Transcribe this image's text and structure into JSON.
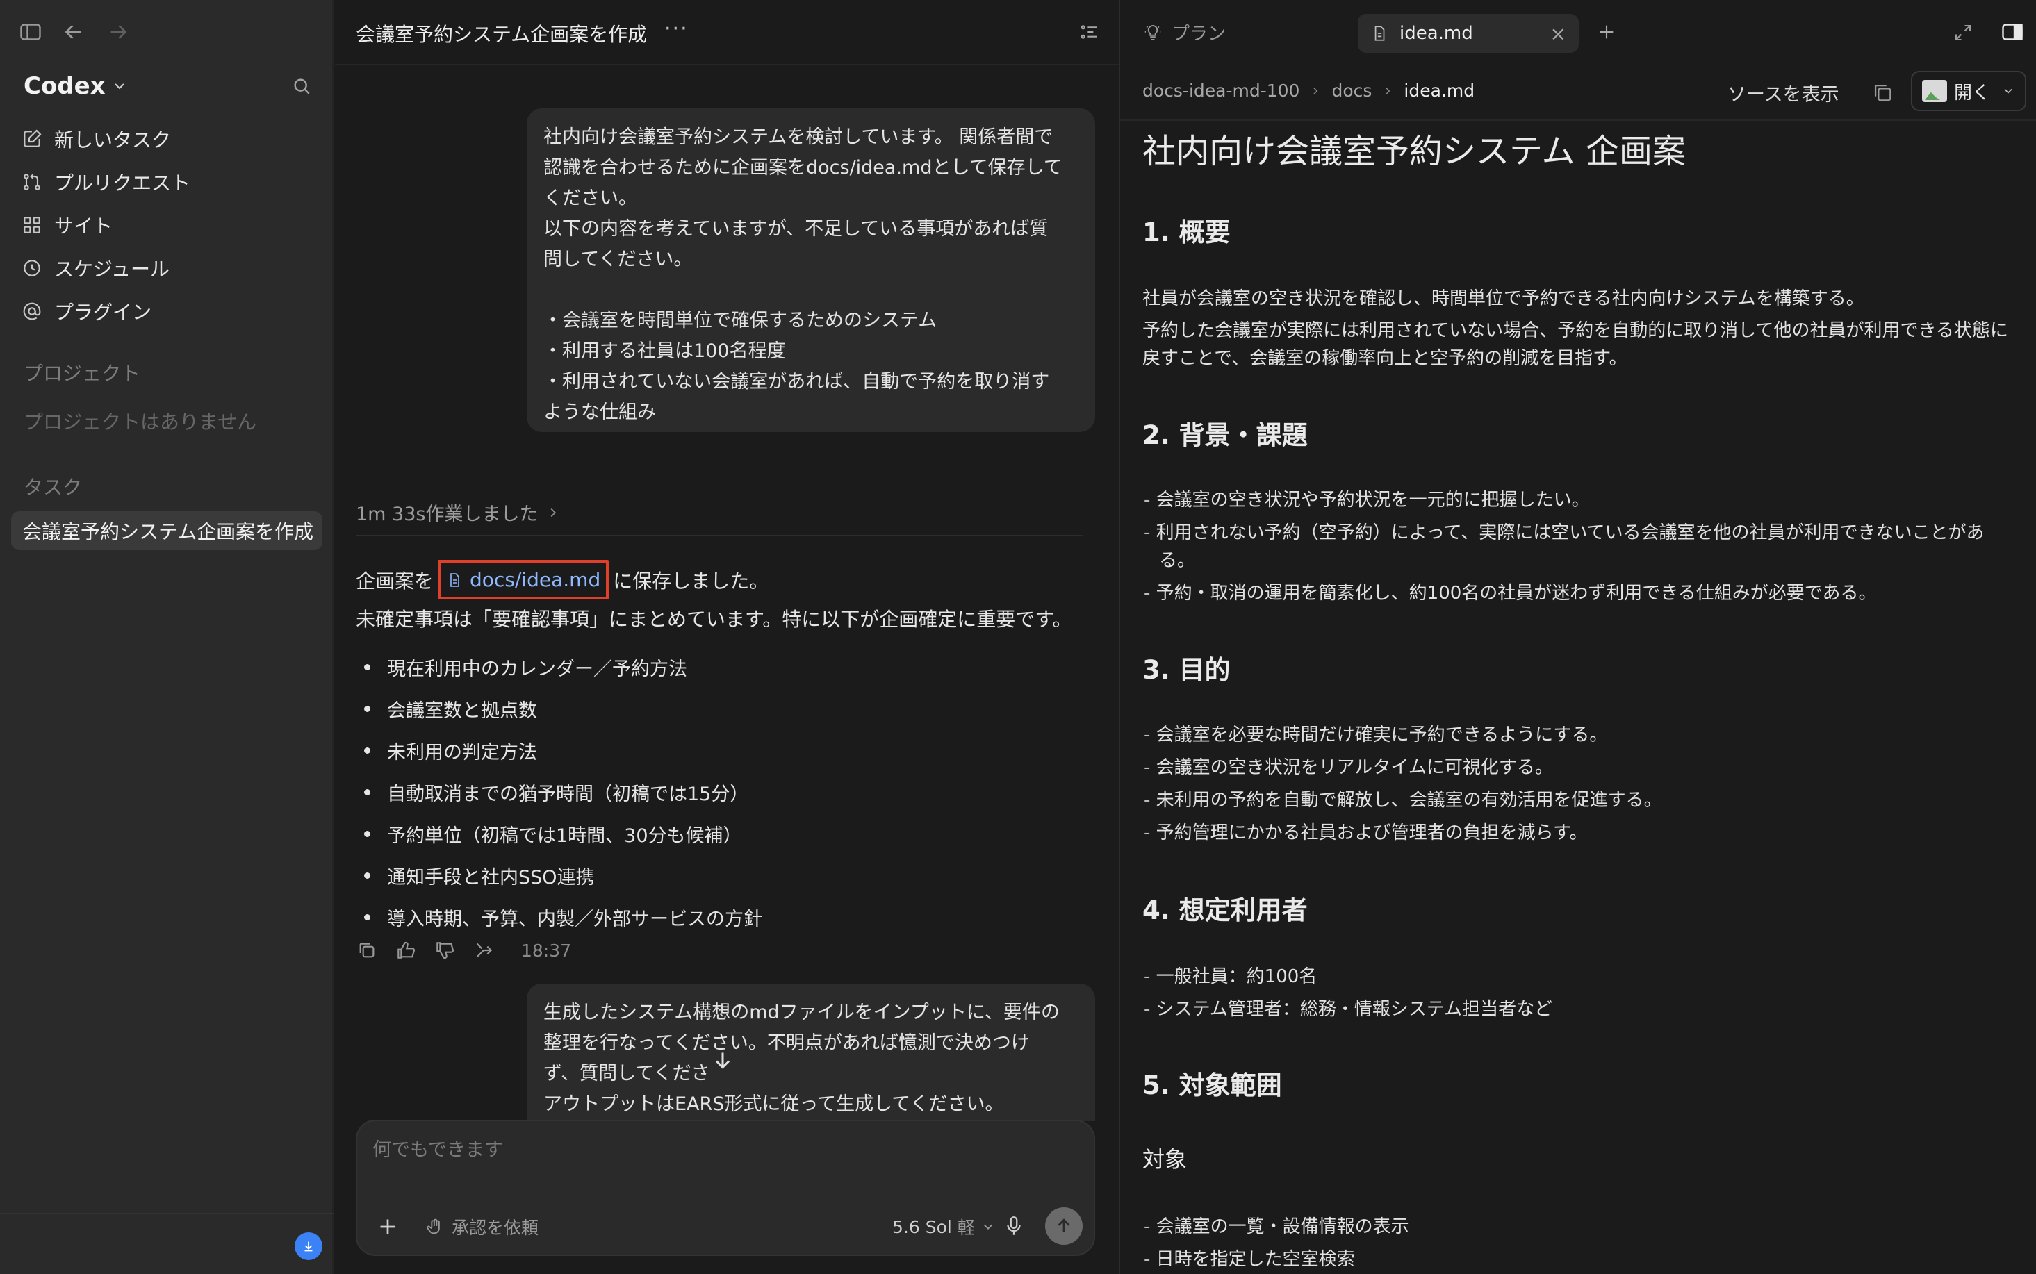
{
  "sidebar": {
    "brand": "Codex",
    "nav": [
      {
        "icon": "edit-icon",
        "label": "新しいタスク"
      },
      {
        "icon": "pull-request-icon",
        "label": "プルリクエスト"
      },
      {
        "icon": "grid-icon",
        "label": "サイト"
      },
      {
        "icon": "clock-icon",
        "label": "スケジュール"
      },
      {
        "icon": "at-icon",
        "label": "プラグイン"
      }
    ],
    "projects_label": "プロジェクト",
    "projects_empty": "プロジェクトはありません",
    "tasks_label": "タスク",
    "active_task": "会議室予約システム企画案を作成"
  },
  "chat": {
    "title": "会議室予約システム企画案を作成",
    "more": "···",
    "user_message_1": "社内向け会議室予約システムを検討しています。 関係者間で\n認識を合わせるために企画案をdocs/idea.mdとして保存して\nください。\n以下の内容を考えていますが、不足している事項があれば質\n問してください。\n\n・会議室を時間単位で確保するためのシステム\n・利用する社員は100名程度\n・利用されていない会議室があれば、自動で予約を取り消す\nような仕組み",
    "worked": "1m 33s作業しました",
    "saved_prefix": "企画案を",
    "file_link": "docs/idea.md",
    "saved_suffix": "に保存しました。",
    "summary": "未確定事項は「要確認事項」にまとめています。特に以下が企画確定に重要です。",
    "bullets": [
      "現在利用中のカレンダー／予約方法",
      "会議室数と拠点数",
      "未利用の判定方法",
      "自動取消までの猶予時間（初稿では15分）",
      "予約単位（初稿では1時間、30分も候補）",
      "通知手段と社内SSO連携",
      "導入時期、予算、内製／外部サービスの方針"
    ],
    "time": "18:37",
    "user_message_2": "生成したシステム構想のmdファイルをインプットに、要件の\n整理を行なってください。不明点があれば憶測で決めつけ\nず、質問してくださ\nアウトプットはEARS形式に従って生成してください。"
  },
  "composer": {
    "placeholder": "何でもできます",
    "approval": "承認を依頼",
    "model": "5.6 Sol",
    "effort": "軽"
  },
  "doc": {
    "tab_plan": "プラン",
    "tab_file": "idea.md",
    "breadcrumb": [
      "docs-idea-md-100",
      "docs",
      "idea.md"
    ],
    "view_source": "ソースを表示",
    "open": "開く",
    "title": "社内向け会議室予約システム 企画案",
    "s1_heading": "1. 概要",
    "s1_p1": "社員が会議室の空き状況を確認し、時間単位で予約できる社内向けシステムを構築する。",
    "s1_p2": "予約した会議室が実際には利用されていない場合、予約を自動的に取り消して他の社員が利用できる状態に戻すことで、会議室の稼働率向上と空予約の削減を目指す。",
    "s2_heading": "2. 背景・課題",
    "s2_items": [
      "会議室の空き状況や予約状況を一元的に把握したい。",
      "利用されない予約（空予約）によって、実際には空いている会議室を他の社員が利用できないことがある。",
      "予約・取消の運用を簡素化し、約100名の社員が迷わず利用できる仕組みが必要である。"
    ],
    "s3_heading": "3. 目的",
    "s3_items": [
      "会議室を必要な時間だけ確実に予約できるようにする。",
      "会議室の空き状況をリアルタイムに可視化する。",
      "未利用の予約を自動で解放し、会議室の有効活用を促進する。",
      "予約管理にかかる社員および管理者の負担を減らす。"
    ],
    "s4_heading": "4. 想定利用者",
    "s4_items": [
      "一般社員：約100名",
      "システム管理者：総務・情報システム担当者など"
    ],
    "s5_heading": "5. 対象範囲",
    "s5_sub": "対象",
    "s5_items": [
      "会議室の一覧・設備情報の表示",
      "日時を指定した空室検索"
    ]
  },
  "colors": {
    "link": "#8fb8ff",
    "highlight_border": "#e0402a",
    "update_badge": "#3b82f6"
  }
}
